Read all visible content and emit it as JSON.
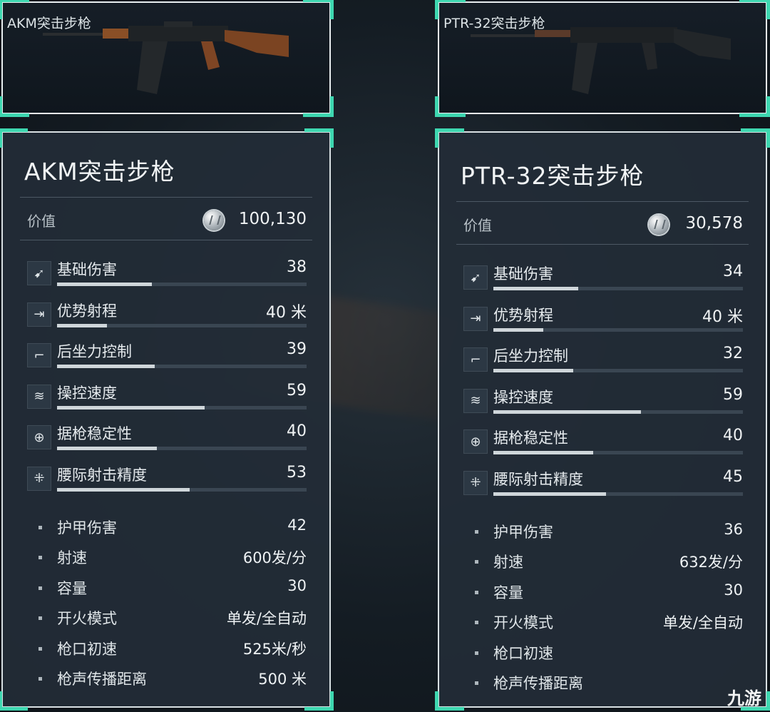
{
  "weapons": [
    {
      "card_label": "AKM突击步枪",
      "title": "AKM突击步枪",
      "value_label": "价值",
      "value": "100,130",
      "stats": [
        {
          "label": "基础伤害",
          "value": "38",
          "percent": 38,
          "icon": "damage-icon"
        },
        {
          "label": "优势射程",
          "value": "40 米",
          "percent": 20,
          "icon": "range-icon"
        },
        {
          "label": "后坐力控制",
          "value": "39",
          "percent": 39,
          "icon": "recoil-icon"
        },
        {
          "label": "操控速度",
          "value": "59",
          "percent": 59,
          "icon": "handling-icon"
        },
        {
          "label": "据枪稳定性",
          "value": "40",
          "percent": 40,
          "icon": "crosshair-icon"
        },
        {
          "label": "腰际射击精度",
          "value": "53",
          "percent": 53,
          "icon": "hipfire-icon"
        }
      ],
      "attributes": [
        {
          "label": "护甲伤害",
          "value": "42"
        },
        {
          "label": "射速",
          "value": "600发/分"
        },
        {
          "label": "容量",
          "value": "30"
        },
        {
          "label": "开火模式",
          "value": "单发/全自动"
        },
        {
          "label": "枪口初速",
          "value": "525米/秒"
        },
        {
          "label": "枪声传播距离",
          "value": "500 米"
        }
      ]
    },
    {
      "card_label": "PTR-32突击步枪",
      "title": "PTR-32突击步枪",
      "value_label": "价值",
      "value": "30,578",
      "stats": [
        {
          "label": "基础伤害",
          "value": "34",
          "percent": 34,
          "icon": "damage-icon"
        },
        {
          "label": "优势射程",
          "value": "40 米",
          "percent": 20,
          "icon": "range-icon"
        },
        {
          "label": "后坐力控制",
          "value": "32",
          "percent": 32,
          "icon": "recoil-icon"
        },
        {
          "label": "操控速度",
          "value": "59",
          "percent": 59,
          "icon": "handling-icon"
        },
        {
          "label": "据枪稳定性",
          "value": "40",
          "percent": 40,
          "icon": "crosshair-icon"
        },
        {
          "label": "腰际射击精度",
          "value": "45",
          "percent": 45,
          "icon": "hipfire-icon"
        }
      ],
      "attributes": [
        {
          "label": "护甲伤害",
          "value": "36"
        },
        {
          "label": "射速",
          "value": "632发/分"
        },
        {
          "label": "容量",
          "value": "30"
        },
        {
          "label": "开火模式",
          "value": "单发/全自动"
        },
        {
          "label": "枪口初速",
          "value": ""
        },
        {
          "label": "枪声传播距离",
          "value": ""
        }
      ]
    }
  ],
  "brand_text": "九游",
  "colors": {
    "accent": "#3ed7b0",
    "panel": "#222c37",
    "bar_fill": "#cfd6da"
  }
}
